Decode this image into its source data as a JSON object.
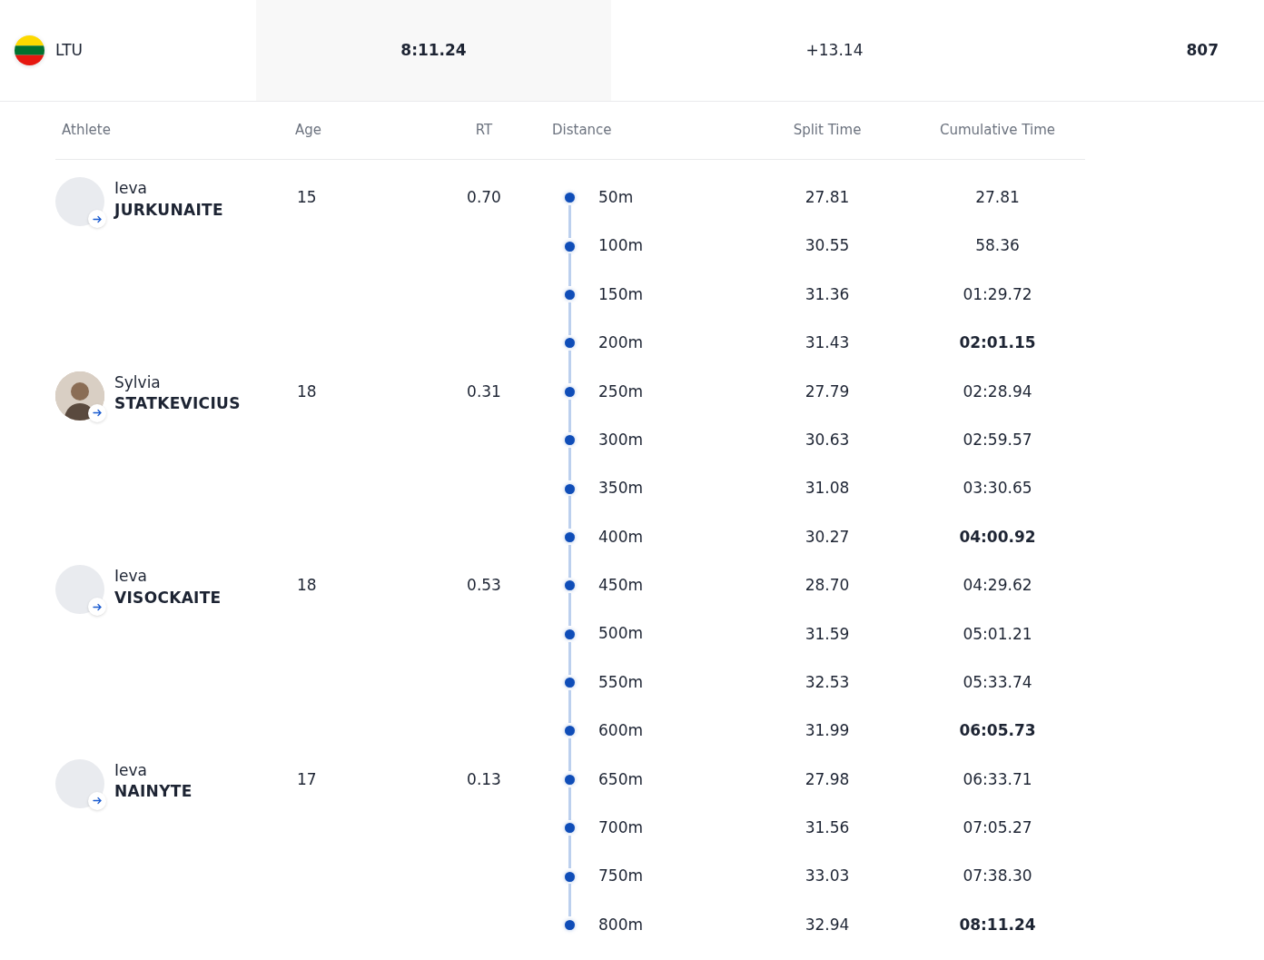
{
  "team": {
    "country": "LTU",
    "time": "8:11.24",
    "behind": "+13.14",
    "points": "807"
  },
  "table": {
    "columns": [
      "Athlete",
      "Age",
      "RT",
      "Distance",
      "Split Time",
      "Cumulative Time"
    ],
    "athletes": [
      {
        "first_name": "Ieva",
        "last_name": "JURKUNAITE",
        "has_photo": false,
        "age": "15",
        "rt": "0.70",
        "splits": [
          {
            "distance": "50m",
            "split": "27.81",
            "cumulative": "27.81",
            "highlighted": false
          },
          {
            "distance": "100m",
            "split": "30.55",
            "cumulative": "58.36",
            "highlighted": false
          },
          {
            "distance": "150m",
            "split": "31.36",
            "cumulative": "01:29.72",
            "highlighted": false
          },
          {
            "distance": "200m",
            "split": "31.43",
            "cumulative": "02:01.15",
            "highlighted": true
          }
        ]
      },
      {
        "first_name": "Sylvia",
        "last_name": "STATKEVICIUS",
        "has_photo": true,
        "age": "18",
        "rt": "0.31",
        "splits": [
          {
            "distance": "250m",
            "split": "27.79",
            "cumulative": "02:28.94",
            "highlighted": false
          },
          {
            "distance": "300m",
            "split": "30.63",
            "cumulative": "02:59.57",
            "highlighted": false
          },
          {
            "distance": "350m",
            "split": "31.08",
            "cumulative": "03:30.65",
            "highlighted": false
          },
          {
            "distance": "400m",
            "split": "30.27",
            "cumulative": "04:00.92",
            "highlighted": true
          }
        ]
      },
      {
        "first_name": "Ieva",
        "last_name": "VISOCKAITE",
        "has_photo": false,
        "age": "18",
        "rt": "0.53",
        "splits": [
          {
            "distance": "450m",
            "split": "28.70",
            "cumulative": "04:29.62",
            "highlighted": false
          },
          {
            "distance": "500m",
            "split": "31.59",
            "cumulative": "05:01.21",
            "highlighted": false
          },
          {
            "distance": "550m",
            "split": "32.53",
            "cumulative": "05:33.74",
            "highlighted": false
          },
          {
            "distance": "600m",
            "split": "31.99",
            "cumulative": "06:05.73",
            "highlighted": true
          }
        ]
      },
      {
        "first_name": "Ieva",
        "last_name": "NAINYTE",
        "has_photo": false,
        "age": "17",
        "rt": "0.13",
        "splits": [
          {
            "distance": "650m",
            "split": "27.98",
            "cumulative": "06:33.71",
            "highlighted": false
          },
          {
            "distance": "700m",
            "split": "31.56",
            "cumulative": "07:05.27",
            "highlighted": false
          },
          {
            "distance": "750m",
            "split": "33.03",
            "cumulative": "07:38.30",
            "highlighted": false
          },
          {
            "distance": "800m",
            "split": "32.94",
            "cumulative": "08:11.24",
            "highlighted": true
          }
        ]
      }
    ]
  }
}
